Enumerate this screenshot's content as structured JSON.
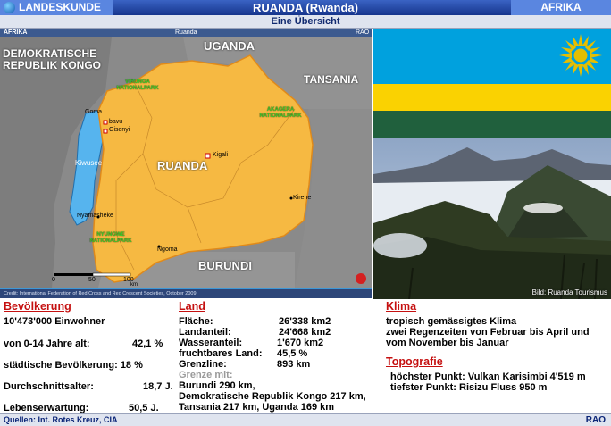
{
  "header": {
    "left_label": "LANDESKUNDE",
    "title": "RUANDA (Rwanda)",
    "right_label": "AFRIKA",
    "subtitle": "Eine Übersicht"
  },
  "map": {
    "bar_left": "AFRIKA",
    "bar_center": "Ruanda",
    "bar_right": "RAO",
    "countries": {
      "drc": "DEMOKRATISCHE REPUBLIK KONGO",
      "uganda": "UGANDA",
      "tanzania": "TANSANIA",
      "burundi": "BURUNDI",
      "rwanda": "RUANDA"
    },
    "parks": {
      "virunga": "VIRUNGA NATIONALPARK",
      "akagera": "AKAGERA NATIONALPARK",
      "nyungwe": "NYUNGWE NATIONALPARK"
    },
    "lake": "Kiwusee",
    "cities": {
      "goma": "Goma",
      "bavu": "bavu",
      "gisenyi": "Gisenyi",
      "kigali": "Kigali",
      "kirehe": "Kirehe",
      "nyamasheke": "Nyamasheke",
      "ngoma": "Ngoma"
    },
    "scale": {
      "a": "0",
      "b": "50",
      "c": "100",
      "unit": "km"
    },
    "credit": "Credit: International Federation of Red Cross and Red Crescent Societies, October 2009"
  },
  "photo": {
    "caption": "Bild: Ruanda Tourismus"
  },
  "flag_colors": {
    "blue": "#00a1de",
    "yellow": "#fad201",
    "green": "#20603d",
    "sun": "#e5be01"
  },
  "bevoelkerung": {
    "heading": "Bevölkerung",
    "einwohner": "10'473'000 Einwohner",
    "jung_label": "von 0-14 Jahre alt:",
    "jung_value": "42,1 %",
    "stadt": "städtische Bevölkerung: 18 %",
    "alter_label": "Durchschnittsalter:",
    "alter_value": "18,7 J.",
    "leben_label": "Lebenserwartung:",
    "leben_value": "50,5 J."
  },
  "land": {
    "heading": "Land",
    "flaeche_label": "Fläche:",
    "flaeche_value": "26'338  km2",
    "landanteil_label": "Landanteil:",
    "landanteil_value": "24'668 km2",
    "wasser_label": "Wasseranteil:",
    "wasser_value": "1'670 km2",
    "frucht_label": "fruchtbares Land:",
    "frucht_value": "45,5 %",
    "grenz_label": "Grenzline:",
    "grenz_value": "893 km",
    "grenze_mit": "Grenze mit:",
    "grenze_1": "Burundi  290 km,",
    "grenze_2": "Demokratische Republik Kongo 217 km,",
    "grenze_3": "Tansania 217 km, Uganda 169 km"
  },
  "klima": {
    "heading": "Klima",
    "line1": "tropisch gemässigtes Klima",
    "line2": "zwei Regenzeiten von Februar bis April und",
    "line3": "vom November bis Januar"
  },
  "topografie": {
    "heading": "Topografie",
    "line1": "höchster Punkt: Vulkan Karisimbi 4'519 m",
    "line2": "tiefster Punkt: Risizu Fluss 950 m"
  },
  "footer": {
    "source": "Quellen: Int. Rotes Kreuz, CIA",
    "brand": "RAO"
  }
}
